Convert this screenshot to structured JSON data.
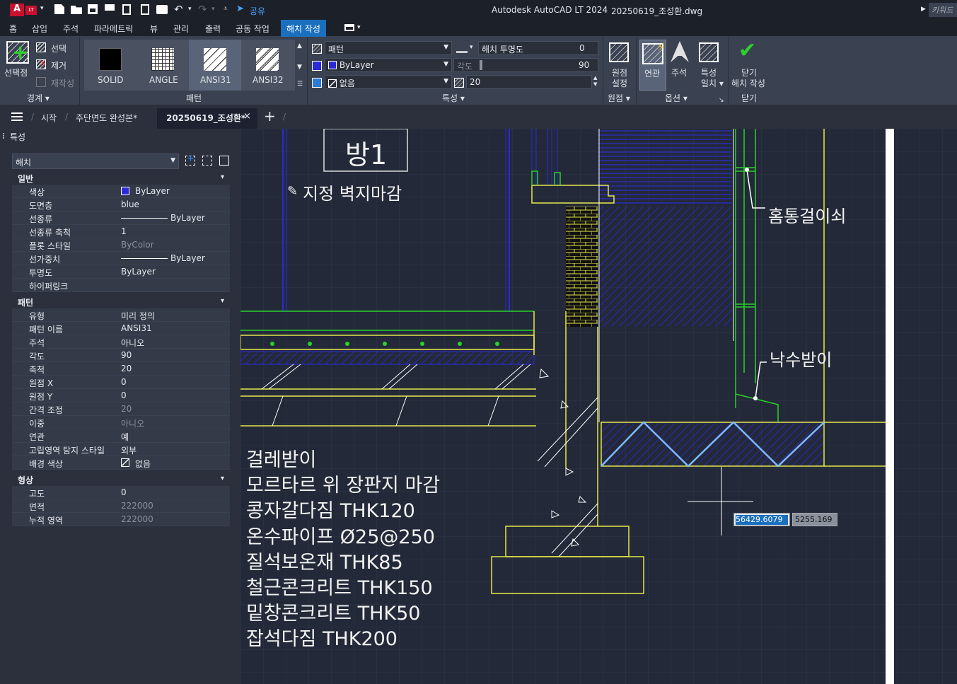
{
  "app": {
    "title": "Autodesk AutoCAD LT 2024",
    "filename": "20250619_조성환.dwg",
    "keyword": "키워드",
    "share": "공유",
    "logo": "A",
    "badge": "LT"
  },
  "menu": [
    "홈",
    "삽입",
    "주석",
    "파라메트릭",
    "뷰",
    "관리",
    "출력",
    "공동 작업",
    "해치 작성"
  ],
  "ribbon": {
    "boundary": {
      "pick_points": "선택점",
      "select": "선택",
      "remove": "제거",
      "recreate": "재작성",
      "label": "경계"
    },
    "patterns": {
      "items": [
        "SOLID",
        "ANGLE",
        "ANSI31",
        "ANSI32"
      ],
      "label": "패턴"
    },
    "properties": {
      "type": "패턴",
      "color": "ByLayer",
      "background": "없음",
      "transparency_label": "해치 투명도",
      "transparency": "0",
      "angle_label": "각도",
      "angle": "90",
      "scale": "20",
      "label": "특성"
    },
    "origin": {
      "set": "원점\n설정",
      "set_l1": "원점",
      "set_l2": "설정",
      "label": "원점"
    },
    "options": {
      "associative": "연관",
      "annotative": "주석",
      "match_l1": "특성",
      "match_l2": "일치",
      "label": "옵션"
    },
    "close": {
      "l1": "닫기",
      "l2": "해치 작성",
      "label": "닫기"
    }
  },
  "doctabs": {
    "start": "시작",
    "tab1": "주단면도 완성본*",
    "tab2": "20250619_조성환*"
  },
  "props": {
    "title": "특성",
    "selector": "해치",
    "general": {
      "header": "일반",
      "rows": [
        {
          "k": "색상",
          "v": "ByLayer"
        },
        {
          "k": "도면층",
          "v": "blue"
        },
        {
          "k": "선종류",
          "v": "ByLayer"
        },
        {
          "k": "선종류 축척",
          "v": "1"
        },
        {
          "k": "플롯 스타일",
          "v": "ByColor"
        },
        {
          "k": "선가중치",
          "v": "ByLayer"
        },
        {
          "k": "투명도",
          "v": "ByLayer"
        },
        {
          "k": "하이퍼링크",
          "v": ""
        }
      ]
    },
    "pattern": {
      "header": "패턴",
      "rows": [
        {
          "k": "유형",
          "v": "미리 정의"
        },
        {
          "k": "패턴 이름",
          "v": "ANSI31"
        },
        {
          "k": "주석",
          "v": "아니오"
        },
        {
          "k": "각도",
          "v": "90"
        },
        {
          "k": "축척",
          "v": "20"
        },
        {
          "k": "원점 X",
          "v": "0"
        },
        {
          "k": "원점 Y",
          "v": "0"
        },
        {
          "k": "간격 조정",
          "v": "20"
        },
        {
          "k": "이중",
          "v": "아니오"
        },
        {
          "k": "연관",
          "v": "예"
        },
        {
          "k": "고립영역 탐지 스타일",
          "v": "외부"
        },
        {
          "k": "배경 색상",
          "v": "없음"
        }
      ]
    },
    "geometry": {
      "header": "형상",
      "rows": [
        {
          "k": "고도",
          "v": "0"
        },
        {
          "k": "면적",
          "v": "222000"
        },
        {
          "k": "누적 영역",
          "v": "222000"
        }
      ]
    }
  },
  "drawing": {
    "room": "방1",
    "wall_finish": "지정 벽지마감",
    "gutter": "홈통걸이쇠",
    "drip": "낙수받이",
    "notes": [
      "걸레받이",
      "모르타르 위 장판지 마감",
      "콩자갈다짐 THK120",
      "온수파이프 Ø25@250",
      "질석보온재 THK85",
      "철근콘크리트 THK150",
      "밑창콘크리트 THK50",
      "잡석다짐 THK200"
    ],
    "coord_x": "56429.6079",
    "coord_y": "5255.169"
  },
  "colors": {
    "accent": "#1a6fbf",
    "canvas": "#232938",
    "yellow": "#e8e84a",
    "green": "#2bd12b",
    "blue": "#2a2ad8",
    "cyan": "#7fb8ff"
  }
}
